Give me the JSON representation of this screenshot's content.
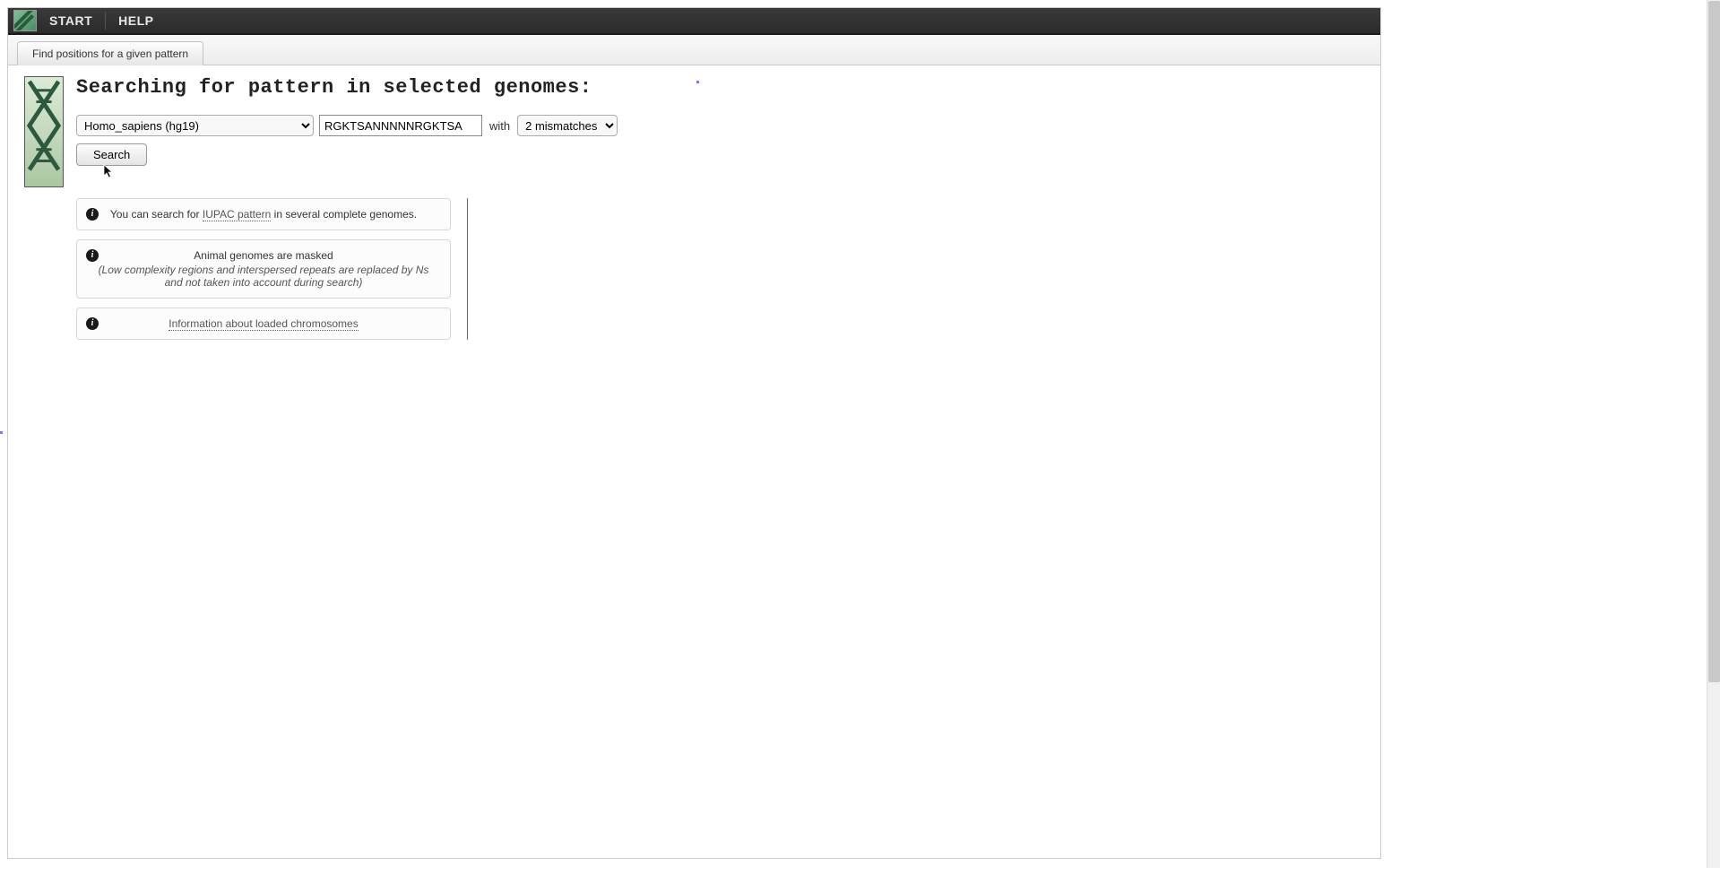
{
  "menu": {
    "start": "START",
    "help": "HELP"
  },
  "tab": {
    "label": "Find positions for a given pattern"
  },
  "heading": "Searching for pattern in selected genomes:",
  "form": {
    "genome_selected": "Homo_sapiens (hg19)",
    "pattern_value": "RGKTSANNNNNRGKTSA",
    "with_label": "with",
    "mismatch_selected": "2 mismatches",
    "search_button": "Search"
  },
  "info": {
    "box1_pre": "You can search for ",
    "box1_link": "IUPAC pattern",
    "box1_post": " in several complete genomes.",
    "box2_title": "Animal genomes are masked",
    "box2_note": "(Low complexity regions and interspersed repeats are replaced by Ns and not taken into account during search)",
    "box3_link": "Information about loaded chromosomes"
  }
}
